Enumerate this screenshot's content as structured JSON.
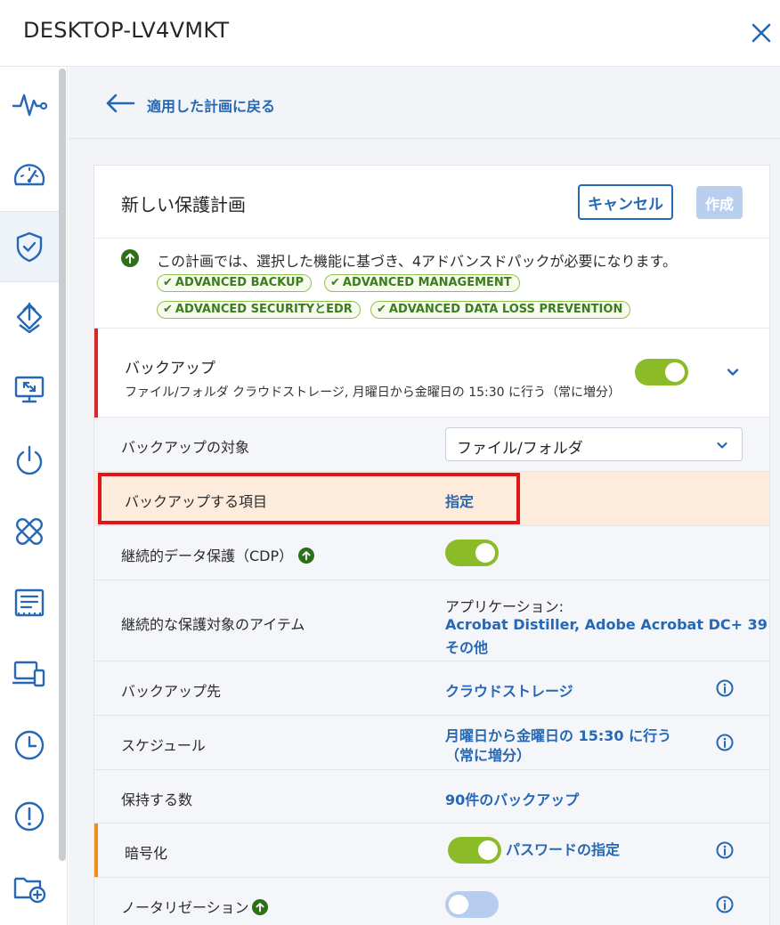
{
  "window": {
    "title": "DESKTOP-LV4VMKT"
  },
  "nav": {
    "back_label": "適用した計画に戻る"
  },
  "plan": {
    "title": "新しい保護計画",
    "cancel_label": "キャンセル",
    "create_label": "作成"
  },
  "notice": {
    "message": "この計画では、選択した機能に基づき、4アドバンスドパックが必要になります。",
    "tags": [
      "ADVANCED BACKUP",
      "ADVANCED MANAGEMENT",
      "ADVANCED SECURITYとEDR",
      "ADVANCED DATA LOSS PREVENTION"
    ]
  },
  "backup": {
    "title": "バックアップ",
    "description": "ファイル/フォルダ クラウドストレージ, 月曜日から金曜日の 15:30 に行う（常に増分）",
    "enabled": true
  },
  "rows": {
    "target_label": "バックアップの対象",
    "target_value": "ファイル/フォルダ",
    "items_label": "バックアップする項目",
    "items_value": "指定",
    "cdp_label": "継続的データ保護（CDP）",
    "cdp_enabled": true,
    "cdp_items_label": "継続的な保護対象のアイテム",
    "cdp_items_heading": "アプリケーション:",
    "cdp_items_value1": "Acrobat Distiller, Adobe Acrobat DC+ 39",
    "cdp_items_value2": "その他",
    "destination_label": "バックアップ先",
    "destination_value": "クラウドストレージ",
    "schedule_label": "スケジュール",
    "schedule_value1": "月曜日から金曜日の 15:30 に行う",
    "schedule_value2": "（常に増分）",
    "retention_label": "保持する数",
    "retention_value": "90件のバックアップ",
    "encryption_label": "暗号化",
    "encryption_enabled": true,
    "encryption_value": "パスワードの指定",
    "notarization_label": "ノータリゼーション",
    "notarization_enabled": false
  },
  "colors": {
    "accent": "#2668b5",
    "toggle_on": "#8cbb2a",
    "toggle_off": "#b7cdf0",
    "highlight": "#e0151b",
    "active_row": "#fdebdc",
    "error_bar": "#d42a2a",
    "warning_bar": "#f08c1a"
  },
  "icons": {
    "sidebar": [
      "activity-icon",
      "dashboard-gauge-icon",
      "shield-check-icon",
      "software-management-icon",
      "remote-desktop-icon",
      "power-icon",
      "patch-icon",
      "inventory-icon",
      "devices-icon",
      "history-clock-icon",
      "alert-icon",
      "add-folder-icon"
    ]
  }
}
